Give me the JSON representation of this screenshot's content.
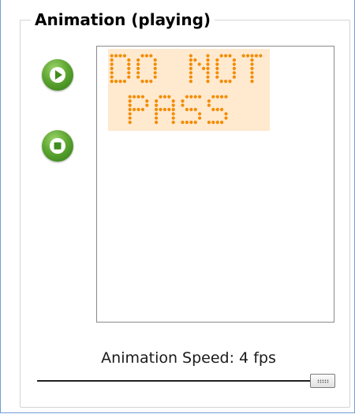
{
  "group": {
    "title": "Animation (playing)"
  },
  "controls": {
    "play_icon": "play-icon",
    "stop_icon": "stop-icon",
    "button_color": "#4f9a2a"
  },
  "display": {
    "led_color": "#f28c00",
    "led_background": "#ffe9cf",
    "lines": [
      "DO NOT",
      "PASS"
    ]
  },
  "speed": {
    "label": "Animation Speed: 4 fps",
    "value_fraction": 1.0
  }
}
